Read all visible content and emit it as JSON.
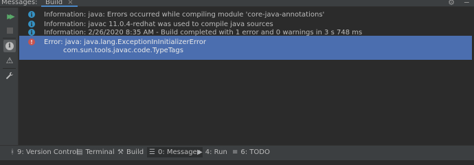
{
  "header": {
    "title": "Messages:",
    "tab_label": "Build",
    "tab_close": "×",
    "gear_glyph": "⚙",
    "minimize_glyph": "−"
  },
  "toolbar": {
    "run_glyph": "▶▶",
    "warn_glyph": "⚠",
    "wrench_glyph": "🔧",
    "info_glyph": "i"
  },
  "messages": [
    {
      "type": "info",
      "icon_glyph": "i",
      "text": "Information: java: Errors occurred while compiling module 'core-java-annotations'"
    },
    {
      "type": "info",
      "icon_glyph": "i",
      "text": "Information: javac 11.0.4-redhat was used to compile java sources"
    },
    {
      "type": "info",
      "icon_glyph": "i",
      "text": "Information: 2/26/2020 8:35 AM - Build completed with 1 error and 0 warnings in 3 s 748 ms"
    }
  ],
  "error": {
    "icon_glyph": "!",
    "text": "Error: java: java.lang.ExceptionInInitializerError",
    "detail": "com.sun.tools.javac.code.TypeTags"
  },
  "bottom_tools": {
    "version_control": "9: Version Control",
    "terminal": "Terminal",
    "build": "Build",
    "messages": "0: Messages",
    "run": "4: Run",
    "todo": "6: TODO"
  },
  "colors": {
    "background": "#2b2b2b",
    "panel": "#3c3f41",
    "selection": "#4b6eaf",
    "info_icon": "#3592c4",
    "error_icon": "#c75450",
    "run_green": "#59a869"
  }
}
